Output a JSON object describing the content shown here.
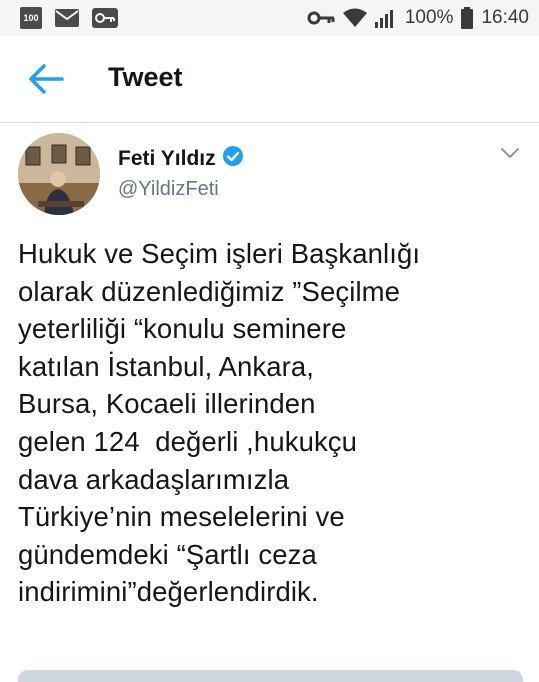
{
  "status_bar": {
    "notification_badge": "100",
    "battery": "100%",
    "time": "16:40"
  },
  "app_bar": {
    "title": "Tweet"
  },
  "tweet": {
    "author_name": "Feti Yıldız",
    "author_handle": "@YildizFeti",
    "verified": true,
    "text_lines": [
      "Hukuk ve Seçim işleri Başkanlığı",
      "olarak düzenlediğimiz ”Seçilme",
      "yeterliliği “konulu seminere",
      "katılan İstanbul, Ankara,",
      "Bursa, Kocaeli illerinden",
      "gelen 124  değerli ,hukukçu",
      "dava arkadaşlarımızla",
      "Türkiye’nin meselelerini ve",
      "gündemdeki “Şartlı ceza",
      "indirimini”değerlendirdik."
    ]
  },
  "colors": {
    "accent": "#1da1f2",
    "text_primary": "#14171a",
    "text_secondary": "#657786"
  }
}
